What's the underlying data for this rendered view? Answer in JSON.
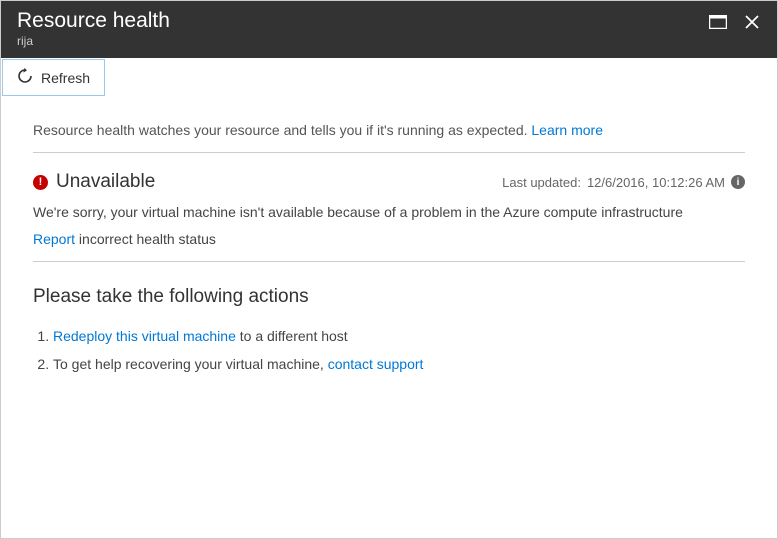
{
  "header": {
    "title": "Resource health",
    "subtitle": "rija"
  },
  "toolbar": {
    "refresh_label": "Refresh"
  },
  "intro": {
    "text": "Resource health watches your resource and tells you if it's running as expected. ",
    "learn_more": "Learn more"
  },
  "status": {
    "title": "Unavailable",
    "last_updated_label": "Last updated: ",
    "last_updated_value": "12/6/2016, 10:12:26 AM",
    "description": "We're sorry, your virtual machine isn't available because of a problem in the Azure compute infrastructure",
    "report_link": "Report",
    "report_suffix": " incorrect health status"
  },
  "actions": {
    "title": "Please take the following actions",
    "items": [
      {
        "link": "Redeploy this virtual machine",
        "suffix": " to a different host"
      },
      {
        "prefix": "To get help recovering your virtual machine, ",
        "link": "contact support"
      }
    ]
  }
}
